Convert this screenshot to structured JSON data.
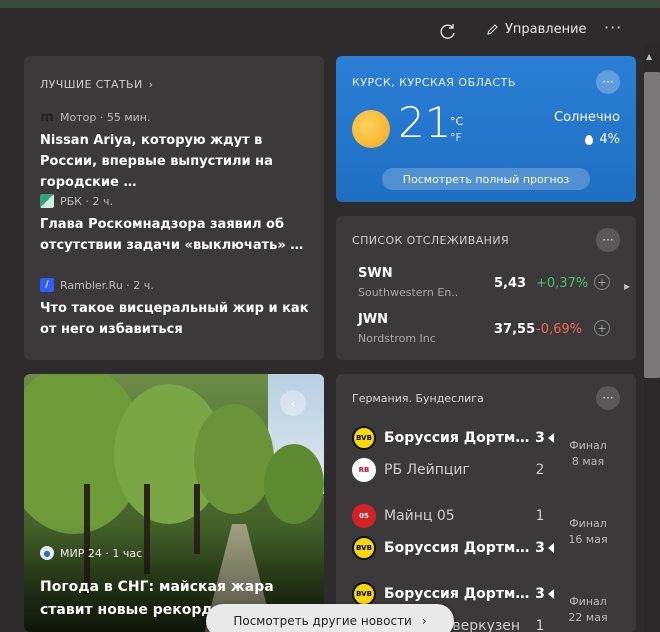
{
  "header": {
    "refresh_icon": "refresh-icon",
    "manage_label": "Управление",
    "more_label": "···"
  },
  "articles": {
    "title": "ЛУЧШИЕ СТАТЬИ",
    "items": [
      {
        "source": "Мотор",
        "time": "55 мин.",
        "meta": "Мотор · 55 мин.",
        "headline": "Nissan Ariya, которую ждут в России, впервые выпустили на городские …",
        "logo_color": "#2a2a2a"
      },
      {
        "source": "РБК",
        "time": "2 ч.",
        "meta": "РБК · 2 ч.",
        "headline": "Глава Роскомнадзора заявил об отсутствии задачи «выключать» …",
        "logo_color": "#2e8b57"
      },
      {
        "source": "Rambler.Ru",
        "time": "2 ч.",
        "meta": "Rambler.Ru · 2 ч.",
        "headline": "Что такое висцеральный жир и как от него избавиться",
        "logo_color": "#315efb"
      }
    ]
  },
  "weather": {
    "location": "КУРСК, КУРСКАЯ ОБЛАСТЬ",
    "temp": "21",
    "unit_c": "°C",
    "unit_f": "°F",
    "condition": "Солнечно",
    "precip": "4%",
    "forecast_btn": "Посмотреть полный прогноз",
    "accent": "#2a7fd6"
  },
  "watchlist": {
    "title": "СПИСОК ОТСЛЕЖИВАНИЯ",
    "stocks": [
      {
        "symbol": "SWN",
        "name": "Southwestern En...",
        "price": "5,43",
        "change": "+0,37%",
        "color": "#4cc36a"
      },
      {
        "symbol": "JWN",
        "name": "Nordstrom Inc",
        "price": "37,55",
        "change": "-0,69%",
        "color": "#f06a5a"
      }
    ]
  },
  "photo_card": {
    "source": "МИР 24 · 1 час",
    "title": "Погода в СНГ: майская жара ставит новые рекорды"
  },
  "sports": {
    "league": "Германия. Бундеслига",
    "matches": [
      {
        "home": "Боруссия Дортм…",
        "home_score": "3",
        "away": "РБ Лейпциг",
        "away_score": "2",
        "status": "Финал",
        "date": "8 мая"
      },
      {
        "home": "Майнц 05",
        "home_score": "1",
        "away": "Боруссия Дортм…",
        "away_score": "3",
        "status": "Финал",
        "date": "16 мая"
      },
      {
        "home": "Боруссия Дортм…",
        "home_score": "3",
        "away": "Байер Леверкузен",
        "away_score": "1",
        "status": "Финал",
        "date": "22 мая"
      }
    ]
  },
  "more_news_btn": "Посмотреть другие новости"
}
